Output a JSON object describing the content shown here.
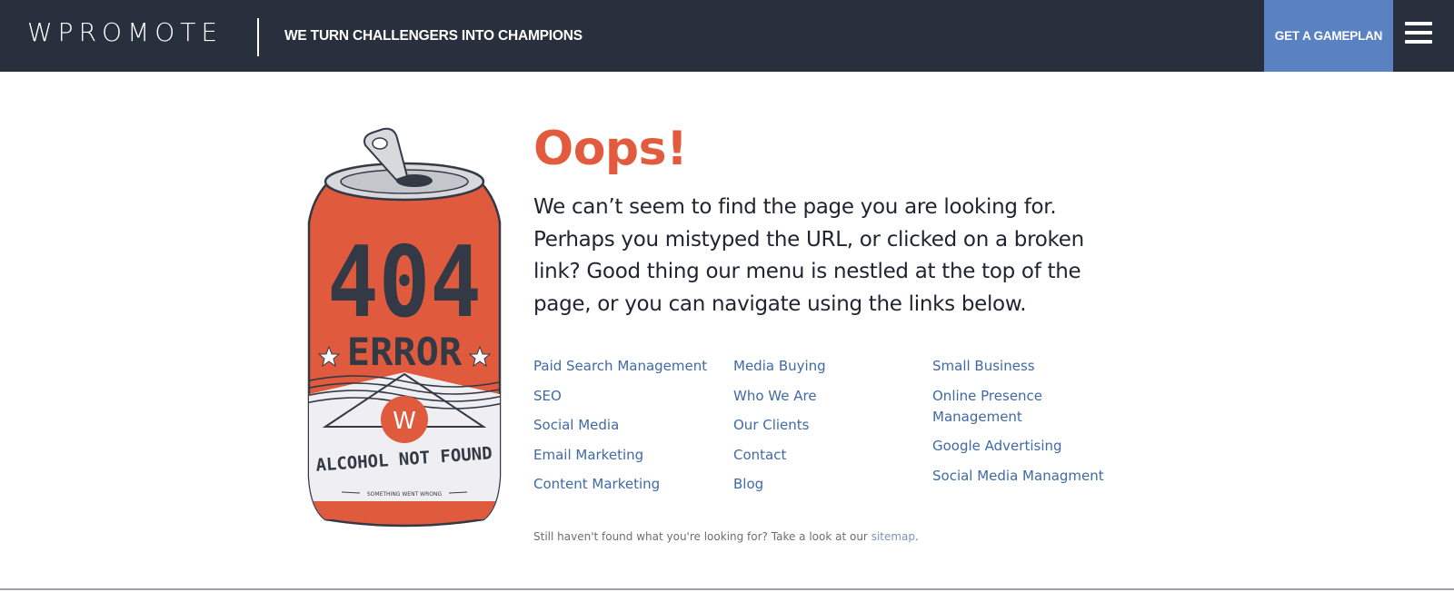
{
  "header": {
    "logo": "WPROMOTE",
    "tagline": "WE TURN CHALLENGERS INTO CHAMPIONS",
    "cta_label": "GET A GAMEPLAN",
    "menu_icon": "hamburger-icon"
  },
  "illustration": {
    "big_number": "404",
    "word": "ERROR",
    "badge_letter": "W",
    "label": "ALCOHOL NOT FOUND",
    "small_label": "SOMETHING WENT WRONG"
  },
  "main": {
    "title": "Oops!",
    "message": "We can’t seem to find the page you are looking for. Perhaps you mistyped the URL, or clicked on a broken link? Good thing our menu is nestled at the top of the page, or you can navigate using the links below.",
    "links": {
      "col1": [
        "Paid Search Management",
        "SEO",
        "Social Media",
        "Email Marketing",
        "Content Marketing"
      ],
      "col2": [
        "Media Buying",
        "Who We Are",
        "Our Clients",
        "Contact",
        "Blog"
      ],
      "col3": [
        "Small Business",
        "Online Presence Management",
        "Google Advertising",
        "Social Media Managment"
      ]
    },
    "footnote_text": "Still haven't found what you're looking for? Take a look at our ",
    "footnote_link": "sitemap",
    "footnote_end": "."
  },
  "colors": {
    "header_bg": "#28303d",
    "cta_bg": "#5a82c3",
    "accent": "#e35b3e",
    "link": "#3f6aa6"
  }
}
